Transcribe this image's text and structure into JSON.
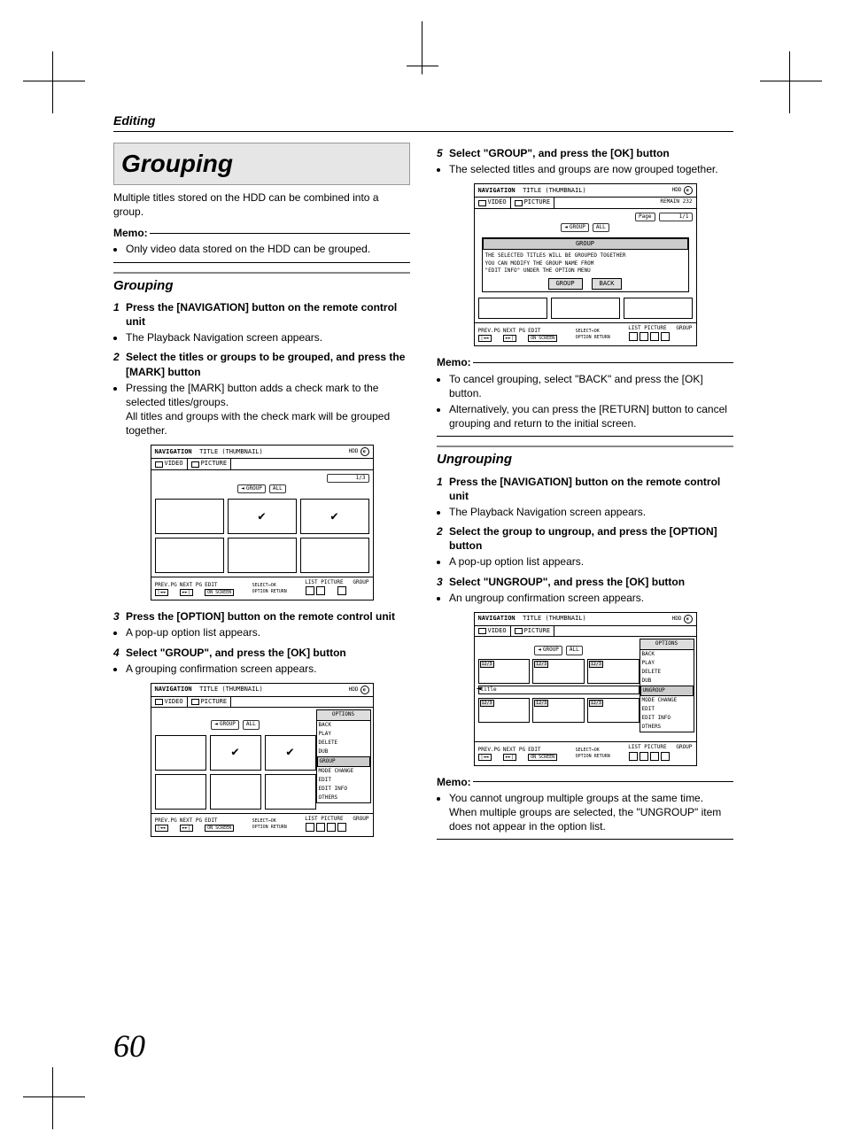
{
  "header": {
    "section": "Editing"
  },
  "page_number": "60",
  "left": {
    "title": "Grouping",
    "intro": "Multiple titles stored on the HDD can be combined into a group.",
    "memo_label": "Memo:",
    "memo_items": [
      "Only video data stored on the HDD can be grouped."
    ],
    "sub_heading": "Grouping",
    "steps": [
      {
        "n": "1",
        "t": "Press the [NAVIGATION] button on the remote control unit",
        "after": [
          "The Playback Navigation screen appears."
        ]
      },
      {
        "n": "2",
        "t": "Select the titles or groups to be grouped, and press the [MARK] button",
        "after": [
          "Pressing the [MARK] button adds a check mark to the selected titles/groups.\nAll titles and groups with the check mark will be grouped together."
        ]
      },
      {
        "n": "3",
        "t": "Press the [OPTION] button on the remote control unit",
        "after": [
          "A pop-up option list appears."
        ]
      },
      {
        "n": "4",
        "t": "Select \"GROUP\", and press the [OK] button",
        "after": [
          "A grouping confirmation screen appears."
        ]
      }
    ]
  },
  "right": {
    "steps": [
      {
        "n": "5",
        "t": "Select \"GROUP\", and press the [OK] button",
        "after": [
          "The selected titles and groups are now grouped together."
        ]
      }
    ],
    "memo_label": "Memo:",
    "memo_items": [
      "To cancel grouping, select \"BACK\" and press the [OK] button.",
      "Alternatively, you can press the [RETURN] button to cancel grouping and return to the initial screen."
    ],
    "sub_heading": "Ungrouping",
    "usteps": [
      {
        "n": "1",
        "t": "Press the [NAVIGATION] button on the remote control unit",
        "after": [
          "The Playback Navigation screen appears."
        ]
      },
      {
        "n": "2",
        "t": "Select the group to ungroup, and press the [OPTION] button",
        "after": [
          "A pop-up option list appears."
        ]
      },
      {
        "n": "3",
        "t": "Select \"UNGROUP\", and press the [OK] button",
        "after": [
          "An ungroup confirmation screen appears."
        ]
      }
    ],
    "memo2_label": "Memo:",
    "memo2_items": [
      "You cannot ungroup multiple groups at the same time. When multiple groups are selected, the \"UNGROUP\" item does not appear in the option list."
    ]
  },
  "fig": {
    "nav": "NAVIGATION",
    "subtitle": "TITLE (THUMBNAIL)",
    "hdd": "HDD",
    "tab_video": "VIDEO",
    "tab_picture": "PICTURE",
    "pagecount": "1/3",
    "pagelabel": "Page",
    "pagecount2": "1/1",
    "remain": "REMAIN 232",
    "group_pill": "GROUP",
    "all_pill": "ALL",
    "footer": {
      "prev": "PREV.PG",
      "next": "NEXT PG",
      "edit": "EDIT",
      "select": "SELECT",
      "ok": "OK",
      "option": "OPTION",
      "return": "RETURN",
      "list": "LIST",
      "picture": "PICTURE",
      "group": "GROUP"
    },
    "options_hdr": "OPTIONS",
    "options": [
      "BACK",
      "PLAY",
      "DELETE",
      "DUB",
      "GROUP",
      "MODE CHANGE",
      "EDIT",
      "EDIT INFO",
      "OTHERS"
    ],
    "uopt": [
      "BACK",
      "PLAY",
      "DELETE",
      "DUB",
      "UNGROUP",
      "MODE CHANGE",
      "EDIT",
      "EDIT INFO",
      "OTHERS"
    ],
    "dialog_hdr": "GROUP",
    "dialog_msg": "THE SELECTED TITLES WILL BE GROUPED TOGETHER\nYOU CAN MODIFY THE GROUP NAME FROM\n\"EDIT INFO\" UNDER THE OPTION MENU",
    "dialog_group": "GROUP",
    "dialog_back": "BACK",
    "title_label": "title",
    "badge123": "12/3"
  }
}
